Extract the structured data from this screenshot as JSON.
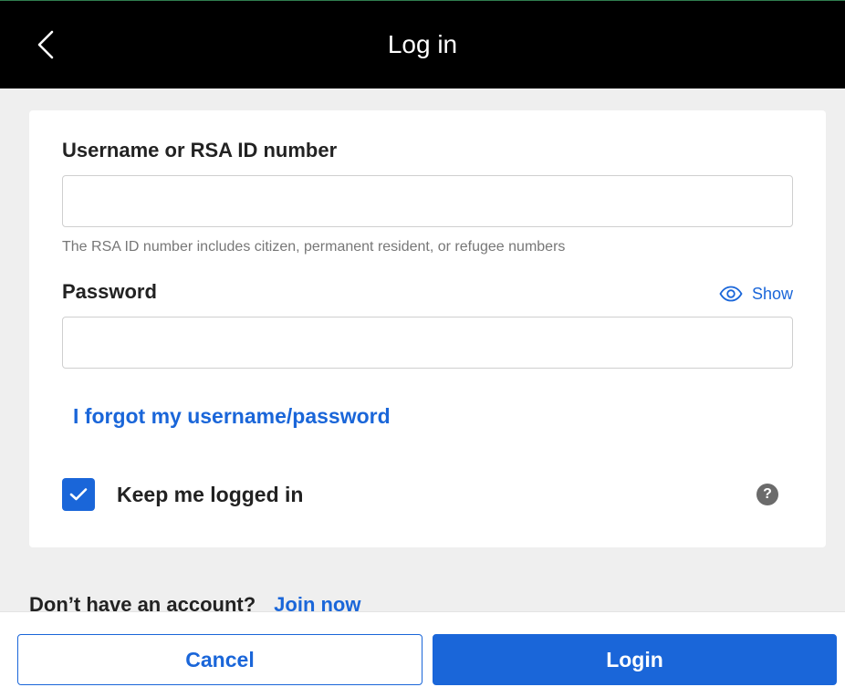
{
  "header": {
    "title": "Log in",
    "back_icon": "chevron-left-icon"
  },
  "form": {
    "username": {
      "label": "Username or RSA ID number",
      "value": "",
      "placeholder": "",
      "hint": "The RSA ID number includes citizen, permanent resident, or refugee numbers"
    },
    "password": {
      "label": "Password",
      "value": "",
      "placeholder": "",
      "show_label": "Show",
      "show_icon": "eye-icon"
    },
    "forgot_link": "I forgot my username/password",
    "keep_logged_in": {
      "label": "Keep me logged in",
      "checked": true,
      "help_icon": "question-icon",
      "help_glyph": "?"
    }
  },
  "signup": {
    "question": "Don’t have an account?",
    "link": "Join now"
  },
  "footer": {
    "cancel_label": "Cancel",
    "login_label": "Login"
  },
  "colors": {
    "accent": "#1a66d9",
    "header_bg": "#000000",
    "page_bg": "#efefef",
    "help_icon_bg": "#6b6b6b"
  }
}
